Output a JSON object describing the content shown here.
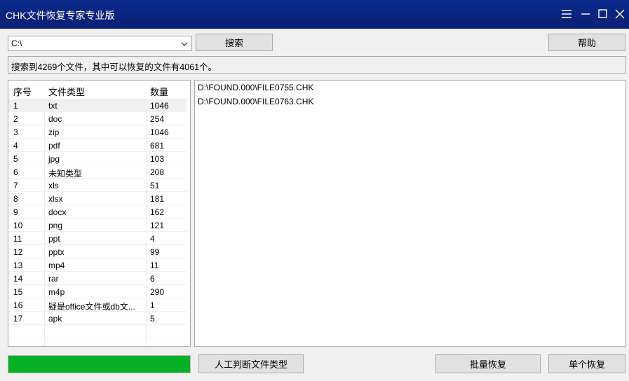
{
  "window": {
    "title": "CHK文件恢复专家专业版"
  },
  "toolbar": {
    "drive_value": "C:\\",
    "search_label": "搜索",
    "help_label": "帮助"
  },
  "status": {
    "text": "搜索到4269个文件，其中可以恢复的文件有4061个。"
  },
  "type_list": {
    "headers": [
      "序号",
      "文件类型",
      "数量"
    ],
    "rows": [
      {
        "no": "1",
        "type": "txt",
        "count": "1046",
        "selected": true
      },
      {
        "no": "2",
        "type": "doc",
        "count": "254"
      },
      {
        "no": "3",
        "type": "zip",
        "count": "1046"
      },
      {
        "no": "4",
        "type": "pdf",
        "count": "681"
      },
      {
        "no": "5",
        "type": "jpg",
        "count": "103"
      },
      {
        "no": "6",
        "type": "未知类型",
        "count": "208"
      },
      {
        "no": "7",
        "type": "xls",
        "count": "51"
      },
      {
        "no": "8",
        "type": "xlsx",
        "count": "181"
      },
      {
        "no": "9",
        "type": "docx",
        "count": "162"
      },
      {
        "no": "10",
        "type": "png",
        "count": "121"
      },
      {
        "no": "11",
        "type": "ppt",
        "count": "4"
      },
      {
        "no": "12",
        "type": "pptx",
        "count": "99"
      },
      {
        "no": "13",
        "type": "mp4",
        "count": "11"
      },
      {
        "no": "14",
        "type": "rar",
        "count": "6"
      },
      {
        "no": "15",
        "type": "m4p",
        "count": "290"
      },
      {
        "no": "16",
        "type": "疑是office文件或db文...",
        "count": "1"
      },
      {
        "no": "17",
        "type": "apk",
        "count": "5"
      }
    ]
  },
  "file_list": {
    "items": [
      "D:\\FOUND.000\\FILE0755.CHK",
      "D:\\FOUND.000\\FILE0763.CHK"
    ]
  },
  "progress": {
    "fraction": 1.0,
    "color": "#06b025"
  },
  "actions": {
    "manual_label": "人工判断文件类型",
    "batch_label": "批量恢复",
    "single_label": "单个恢复"
  },
  "icons": {
    "menu": "hamburger-menu-icon",
    "minimize": "minimize-icon",
    "maximize": "maximize-icon",
    "close": "close-icon",
    "dropdown": "chevron-down-icon"
  }
}
